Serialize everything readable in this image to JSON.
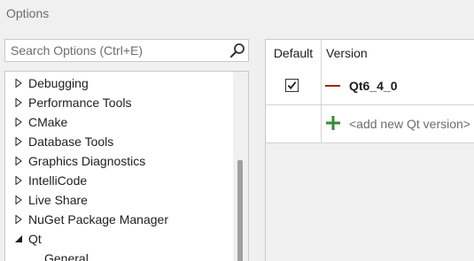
{
  "window": {
    "title": "Options"
  },
  "search": {
    "placeholder": "Search Options (Ctrl+E)",
    "icon": "search-icon"
  },
  "tree": {
    "items": [
      {
        "label": "Debugging",
        "state": "collapsed"
      },
      {
        "label": "Performance Tools",
        "state": "collapsed"
      },
      {
        "label": "CMake",
        "state": "collapsed"
      },
      {
        "label": "Database Tools",
        "state": "collapsed"
      },
      {
        "label": "Graphics Diagnostics",
        "state": "collapsed"
      },
      {
        "label": "IntelliCode",
        "state": "collapsed"
      },
      {
        "label": "Live Share",
        "state": "collapsed"
      },
      {
        "label": "NuGet Package Manager",
        "state": "collapsed"
      },
      {
        "label": "Qt",
        "state": "expanded"
      },
      {
        "label": "General",
        "state": "child"
      }
    ]
  },
  "versions": {
    "headers": {
      "default": "Default",
      "version": "Version"
    },
    "rows": [
      {
        "name": "Qt6_4_0",
        "default": true
      }
    ],
    "add_label": "<add new Qt version>"
  },
  "colors": {
    "accent": "#a1260d",
    "add_green": "#388a34"
  }
}
